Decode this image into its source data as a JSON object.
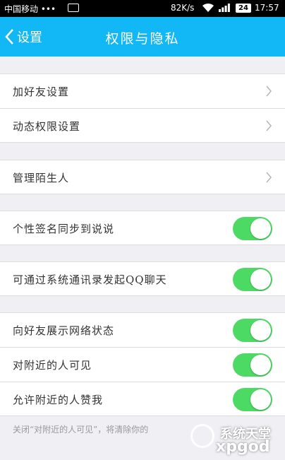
{
  "status_bar": {
    "carrier": "中国移动 •••",
    "network_speed": "82K/s",
    "battery": "24",
    "time": "17:57"
  },
  "nav": {
    "back_label": "设置",
    "title": "权限与隐私"
  },
  "sections": [
    {
      "rows": [
        {
          "label": "加好友设置",
          "control": "chevron"
        },
        {
          "label": "动态权限设置",
          "control": "chevron"
        }
      ]
    },
    {
      "rows": [
        {
          "label": "管理陌生人",
          "control": "chevron"
        }
      ]
    },
    {
      "rows": [
        {
          "label": "个性签名同步到说说",
          "control": "toggle",
          "on": true
        }
      ]
    },
    {
      "rows": [
        {
          "label": "可通过系统通讯录发起QQ聊天",
          "control": "toggle",
          "on": true
        }
      ]
    },
    {
      "rows": [
        {
          "label": "向好友展示网络状态",
          "control": "toggle",
          "on": true
        },
        {
          "label": "对附近的人可见",
          "control": "toggle",
          "on": true
        },
        {
          "label": "允许附近的人赞我",
          "control": "toggle",
          "on": true
        }
      ]
    }
  ],
  "footer_note": "关闭“对附近的人可见”，将清除你的",
  "watermark": {
    "chinese": "系统天堂",
    "latin": "xpgod"
  },
  "colors": {
    "nav_blue": "#12b7f5",
    "toggle_green": "#4cd964",
    "background": "#efeff4"
  }
}
